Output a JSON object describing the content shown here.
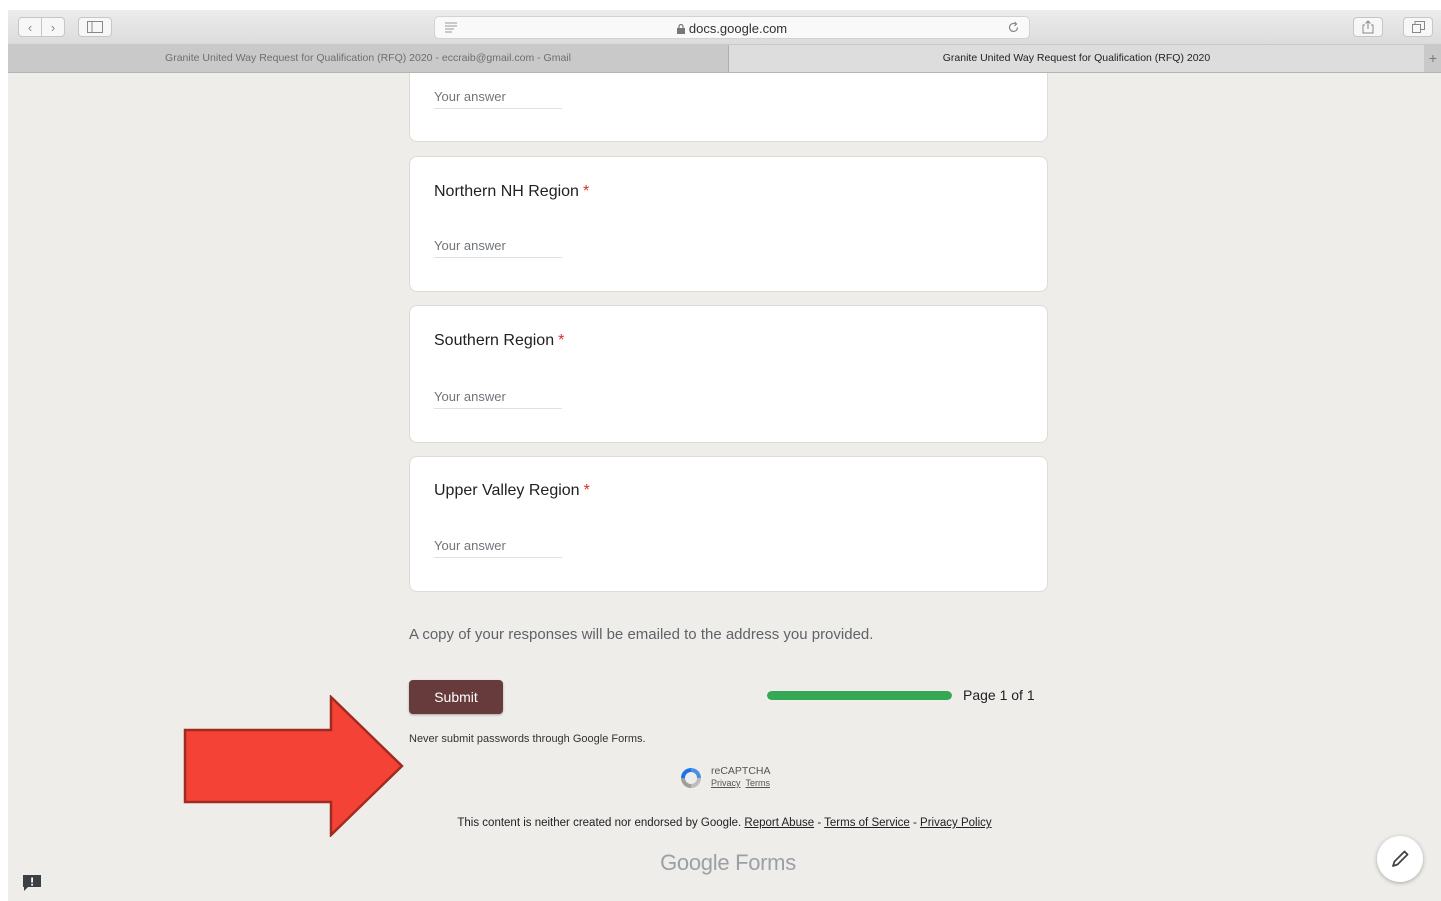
{
  "browser": {
    "url": "docs.google.com",
    "tabs": [
      {
        "label": "Granite United Way Request for Qualification (RFQ) 2020 - eccraib@gmail.com - Gmail",
        "active": false
      },
      {
        "label": "Granite United Way Request for Qualification (RFQ) 2020",
        "active": true
      }
    ]
  },
  "form": {
    "questions": [
      {
        "title": "",
        "placeholder": "Your answer",
        "required": false
      },
      {
        "title": "Northern NH Region",
        "placeholder": "Your answer",
        "required": true
      },
      {
        "title": "Southern Region",
        "placeholder": "Your answer",
        "required": true
      },
      {
        "title": "Upper Valley Region",
        "placeholder": "Your answer",
        "required": true
      }
    ],
    "required_mark": "*",
    "confirmation_text": "A copy of your responses will be emailed to the address you provided.",
    "submit_label": "Submit",
    "progress_fraction": 1.0,
    "page_indicator": "Page 1 of 1",
    "password_warning": "Never submit passwords through Google Forms."
  },
  "recaptcha": {
    "name": "reCAPTCHA",
    "privacy": "Privacy",
    "terms": "Terms"
  },
  "footer": {
    "disclaimer_prefix": "This content is neither created nor endorsed by Google.",
    "report_abuse": "Report Abuse",
    "separator": "-",
    "terms_of_service": "Terms of Service",
    "privacy_policy": "Privacy Policy",
    "logo_text": "Google Forms"
  },
  "colors": {
    "submit_bg": "#673b3b",
    "progress": "#34a853",
    "required": "#d93025",
    "annotation_arrow": "#f44336"
  }
}
